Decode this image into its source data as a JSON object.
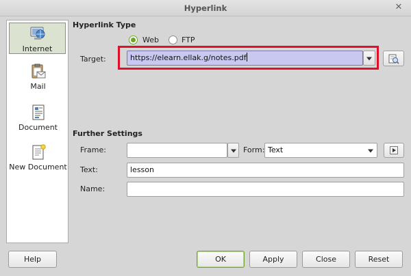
{
  "window": {
    "title": "Hyperlink",
    "close_glyph": "✕"
  },
  "sidebar": {
    "items": [
      {
        "label": "Internet",
        "icon": "globe-computer-icon",
        "selected": true
      },
      {
        "label": "Mail",
        "icon": "mail-clipboard-icon",
        "selected": false
      },
      {
        "label": "Document",
        "icon": "document-icon",
        "selected": false
      },
      {
        "label": "New Document",
        "icon": "new-document-icon",
        "selected": false
      }
    ]
  },
  "hyperlink_type": {
    "title": "Hyperlink Type",
    "options": [
      {
        "label": "Web",
        "checked": true
      },
      {
        "label": "FTP",
        "checked": false
      }
    ],
    "target_label": "Target:",
    "target_value": "https://elearn.ellak.g/notes.pdf"
  },
  "further_settings": {
    "title": "Further Settings",
    "frame_label": "Frame:",
    "frame_value": "",
    "form_label": "Form:",
    "form_value": "Text",
    "text_label": "Text:",
    "text_value": "lesson",
    "name_label": "Name:",
    "name_value": ""
  },
  "buttons": {
    "help": "Help",
    "ok": "OK",
    "apply": "Apply",
    "close": "Close",
    "reset": "Reset"
  },
  "colors": {
    "highlight": "#e0102a",
    "accent_green": "#6ea32e",
    "selected_field": "#c8c8f0"
  }
}
